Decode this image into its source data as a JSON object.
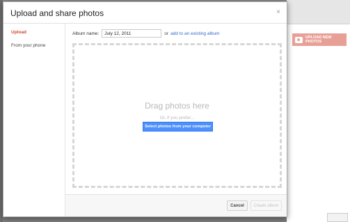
{
  "dialog": {
    "title": "Upload and share photos",
    "close_glyph": "×"
  },
  "sidebar": {
    "items": [
      {
        "label": "Upload",
        "active": true
      },
      {
        "label": "From your phone",
        "active": false
      }
    ]
  },
  "album": {
    "label": "Album name:",
    "value": "July 12, 2011",
    "or_text": "or",
    "existing_link": "add to an existing album"
  },
  "dropzone": {
    "drag_text": "Drag photos here",
    "prefer_text": "Or, if you prefer...",
    "select_button": "Select photos from your computer"
  },
  "footer": {
    "cancel_label": "Cancel",
    "create_label": "Create album"
  },
  "background": {
    "upload_new_photos": "UPLOAD NEW PHOTOS"
  },
  "colors": {
    "accent_red": "#d14836",
    "primary_blue": "#4d90fe",
    "link_blue": "#3366cc"
  }
}
